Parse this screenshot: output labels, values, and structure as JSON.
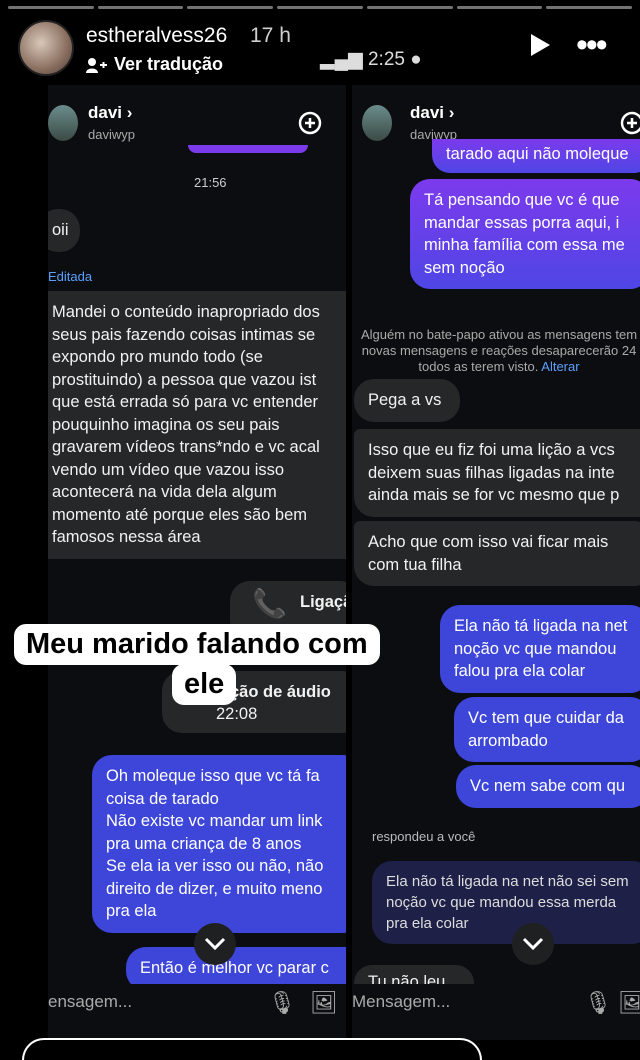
{
  "story": {
    "username": "estheralvess26",
    "time": "17 h",
    "translate": "Ver tradução",
    "status_time": "2:25"
  },
  "left": {
    "name": "davi",
    "handle": "daviwyp",
    "timestamp": "21:56",
    "oii": "oii",
    "edited": "Editada",
    "long_msg": "Mandei o conteúdo inapropriado dos\nseus pais fazendo coisas intimas se\nexpondo pro mundo todo (se\nprostituindo) a pessoa que vazou ist\nque está errada só para vc entender\npouquinho imagina os seu pais\ngravarem vídeos trans*ndo e vc acal\nvendo um vídeo que vazou isso\nacontecerá na vida dela algum\nmomento até porque eles são bem\nfamosos nessa área",
    "call_label": "Ligaçã",
    "audio_label": "ção de áudio",
    "audio_time": "22:08",
    "out_msg": "Oh moleque isso que vc tá fa\ncoisa de tarado\nNão existe vc mandar um link\npra uma criança de 8 anos\nSe ela ia ver isso ou não, não\ndireito de dizer, e muito meno\npra ela",
    "out_msg2": "Então é melhor vc parar c\nidéias aí pq se não vc vai",
    "input_placeholder": "ensagem..."
  },
  "right": {
    "name": "davi",
    "handle": "daviwyp",
    "top_cut": "tarado aqui não moleque",
    "purple_msg": "Tá pensando que vc é que\nmandar essas porra aqui, i\nminha família com essa me\nsem noção",
    "system_note": "Alguém no bate-papo ativou as mensagens tem\nnovas mensagens e reações desaparecerão 24\ntodos as terem visto.",
    "system_link": "Alterar",
    "pega": "Pega a vs",
    "licao": "Isso que eu fiz foi uma lição a vcs\ndeixem suas filhas ligadas na inte\nainda mais se for vc mesmo que p",
    "acho": "Acho que com isso vai ficar mais\ncom tua filha",
    "blue1": "Ela não tá ligada na net\nnoção vc que mandou\nfalou pra ela colar",
    "blue2": "Vc tem que cuidar da\narrombado",
    "blue3": "Vc nem sabe com qu",
    "replied": "respondeu a você",
    "reply_quote": "Ela não tá ligada na net não sei sem\nnoção vc que mandou essa merda\npra ela colar",
    "last_in": "Tu não leu nao",
    "input_placeholder": "Mensagem..."
  },
  "caption": {
    "line1": "Meu marido falando com",
    "line2": "ele"
  }
}
